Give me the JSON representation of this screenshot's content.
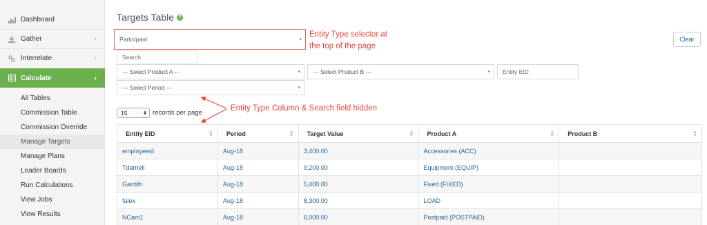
{
  "sidebar": {
    "items": [
      {
        "label": "Dashboard",
        "icon": "bar-chart-icon"
      },
      {
        "label": "Gather",
        "icon": "download-icon",
        "chevron": "‹"
      },
      {
        "label": "Interrelate",
        "icon": "link-icon",
        "chevron": "‹"
      },
      {
        "label": "Calculate",
        "icon": "table-icon",
        "chevron": "‹",
        "active": true
      }
    ],
    "subitems": [
      {
        "label": "All Tables"
      },
      {
        "label": "Commission Table"
      },
      {
        "label": "Commission Override"
      },
      {
        "label": "Manage Targets",
        "selected": true
      },
      {
        "label": "Manage Plans"
      },
      {
        "label": "Leader Boards"
      },
      {
        "label": "Run Calculations"
      },
      {
        "label": "View Jobs"
      },
      {
        "label": "View Results"
      }
    ]
  },
  "page": {
    "title": "Targets Table",
    "help_glyph": "?"
  },
  "filters": {
    "entity_type": "Participant",
    "search_placeholder": "Search",
    "product_a": "--- Select Product A ---",
    "product_b": "--- Select Product B ---",
    "entity_eid_placeholder": "Entity EID",
    "period": "--- Select Period ---",
    "clear_label": "Clear"
  },
  "annotations": {
    "entity_selector_line1": "Entity Type selector at",
    "entity_selector_line2": "the top of the page",
    "hidden_note": "Entity Type Column & Search field hidden"
  },
  "pagination": {
    "per_page_value": "15",
    "per_page_label": "records per page"
  },
  "table": {
    "columns": [
      "Entity EID",
      "Period",
      "Target Value",
      "Product A",
      "Product B"
    ],
    "rows": [
      [
        "employeeid",
        "Aug-18",
        "3,400.00",
        "Accessories (ACC)",
        ""
      ],
      [
        "Tdarnell",
        "Aug-18",
        "9,200.00",
        "Equipment (EQUIP)",
        ""
      ],
      [
        "Gardith",
        "Aug-18",
        "5,400.00",
        "Fixed (FIXED)",
        ""
      ],
      [
        "falex",
        "Aug-18",
        "8,300.00",
        "LOAD",
        ""
      ],
      [
        "NCam1",
        "Aug-18",
        "6,000.00",
        "Postpaid (POSTPAID)",
        ""
      ]
    ]
  },
  "colors": {
    "accent_green": "#6ab04c",
    "annotation_red": "#e8463a",
    "link_blue": "#2a6496"
  }
}
